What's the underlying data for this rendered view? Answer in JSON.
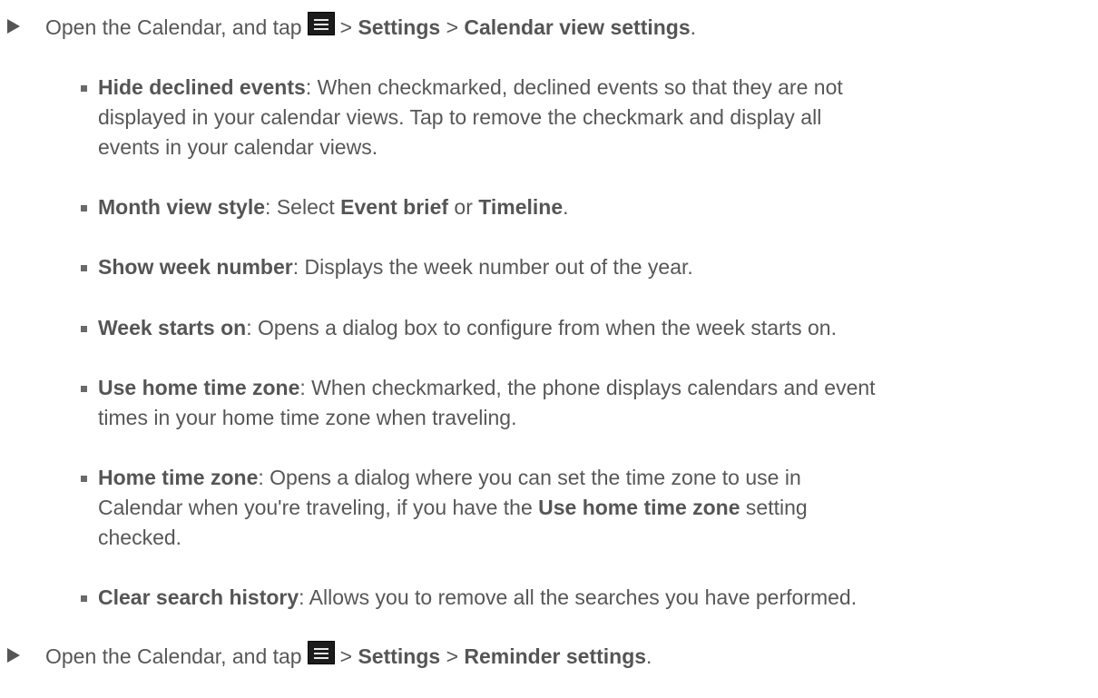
{
  "step1": {
    "prefix": "Open the Calendar, and tap",
    "sep1": ">",
    "settings": "Settings",
    "sep2": ">",
    "target": "Calendar view settings",
    "end": "."
  },
  "options": [
    {
      "term": "Hide declined events",
      "lines": [
        ": When checkmarked, declined events so that they are not",
        "displayed in your calendar views. Tap to remove the checkmark and display all",
        "events in your calendar views."
      ]
    },
    {
      "term": "Month view style",
      "desc_a": ": Select ",
      "choice1": "Event brief",
      "desc_b": " or ",
      "choice2": "Timeline",
      "desc_c": "."
    },
    {
      "term": "Show week number",
      "desc": ": Displays the week number out of the year."
    },
    {
      "term": "Week starts on",
      "desc": ": Opens a dialog box to configure from when the week starts on."
    },
    {
      "term": "Use home time zone",
      "lines": [
        ": When checkmarked, the phone displays calendars and event",
        "times in your home time zone when traveling."
      ]
    },
    {
      "term": "Home time zone",
      "line1": ": Opens a dialog where you can set the time zone to use in",
      "line2a": "Calendar when you're traveling, if you have the ",
      "line2b": "Use home time zone",
      "line2c": " setting",
      "line3": "checked."
    },
    {
      "term": "Clear search history",
      "desc": ": Allows you to remove all the searches you have performed."
    }
  ],
  "step2": {
    "prefix": "Open the Calendar, and tap",
    "sep1": ">",
    "settings": "Settings",
    "sep2": ">",
    "target": "Reminder settings",
    "end": "."
  },
  "icons": {
    "menu": "menu-icon",
    "step_marker": "triangle-right-icon",
    "bullet": "square-bullet-icon"
  },
  "colors": {
    "text": "#575757",
    "bold": "#555555",
    "icon_bg": "#1c1c1c"
  }
}
